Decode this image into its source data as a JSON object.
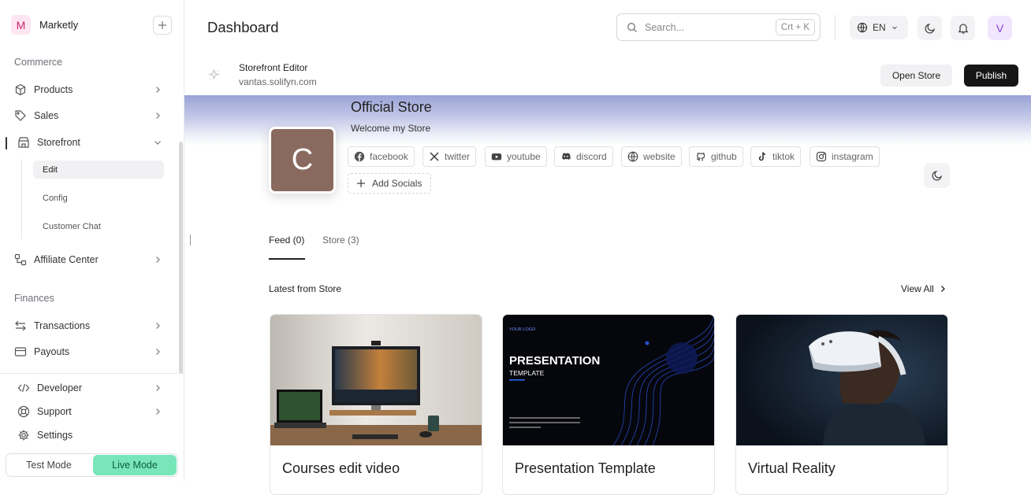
{
  "sidebar": {
    "brand": {
      "initial": "M",
      "name": "Marketly"
    },
    "commerce_label": "Commerce",
    "items": {
      "products": "Products",
      "sales": "Sales",
      "storefront": "Storefront",
      "affiliate": "Affiliate Center",
      "transactions": "Transactions",
      "payouts": "Payouts",
      "developer": "Developer",
      "support": "Support",
      "settings": "Settings"
    },
    "storefront_sub": [
      "Edit",
      "Config",
      "Customer Chat"
    ],
    "finances_label": "Finances",
    "mode": {
      "test": "Test Mode",
      "live": "Live Mode"
    }
  },
  "header": {
    "title": "Dashboard",
    "search_placeholder": "Search...",
    "search_shortcut": "Crt + K",
    "language": "EN",
    "user_initial": "V"
  },
  "editor": {
    "title": "Storefront Editor",
    "url": "vantas.solifyn.com",
    "open_store": "Open Store",
    "publish": "Publish"
  },
  "store": {
    "avatar_initial": "C",
    "name": "Official Store",
    "welcome": "Welcome my Store",
    "socials": [
      "facebook",
      "twitter",
      "youtube",
      "discord",
      "website",
      "github",
      "tiktok",
      "instagram"
    ],
    "add_socials": "Add Socials",
    "tabs": [
      "Feed (0)",
      "Store (3)"
    ],
    "latest_label": "Latest from Store",
    "view_all": "View All",
    "cards": [
      {
        "title": "Courses edit video"
      },
      {
        "title": "Presentation Template",
        "image_heading": "PRESENTATION",
        "image_sub": "TEMPLATE",
        "image_logo": "YOUR LOGO"
      },
      {
        "title": "Virtual Reality"
      }
    ]
  },
  "colors": {
    "live_mode": "#79e6b9",
    "publish": "#161616",
    "store_avatar": "#8a6a5e"
  }
}
